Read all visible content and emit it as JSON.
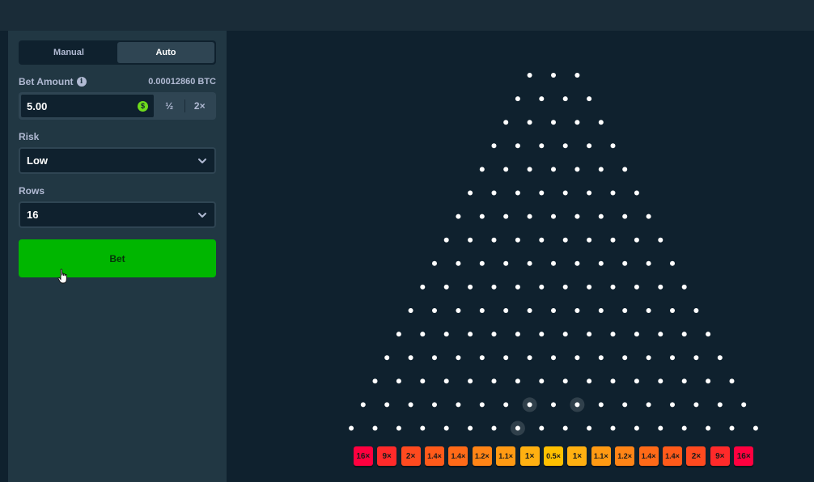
{
  "sidebar": {
    "tabs": [
      {
        "label": "Manual",
        "active": false
      },
      {
        "label": "Auto",
        "active": true
      }
    ],
    "bet_amount": {
      "label": "Bet Amount",
      "btc_value": "0.00012860 BTC",
      "value": "5.00",
      "half_label": "½",
      "double_label": "2×"
    },
    "risk": {
      "label": "Risk",
      "value": "Low"
    },
    "rows": {
      "label": "Rows",
      "value": "16"
    },
    "bet_button": "Bet"
  },
  "board": {
    "peg_rows": 16,
    "top_row_pegs": 3,
    "highlighted_pegs": [
      [
        14,
        7
      ],
      [
        14,
        9
      ],
      [
        15,
        7
      ]
    ],
    "multipliers": [
      "16×",
      "9×",
      "2×",
      "1.4×",
      "1.4×",
      "1.2×",
      "1.1×",
      "1×",
      "0.5×",
      "1×",
      "1.1×",
      "1.2×",
      "1.4×",
      "1.4×",
      "2×",
      "9×",
      "16×"
    ],
    "slot_colors": [
      "#ff003f",
      "#ff2a2a",
      "#ff4a1f",
      "#ff5a1a",
      "#ff6a18",
      "#ff8416",
      "#ff9a13",
      "#ffb011",
      "#ffc000",
      "#ffb011",
      "#ff9a13",
      "#ff8416",
      "#ff6a18",
      "#ff5a1a",
      "#ff4a1f",
      "#ff2a2a",
      "#ff003f"
    ]
  },
  "colors": {
    "background": "#0f212e",
    "panel": "#213743",
    "bet_green": "#00b600",
    "peg": "#ffffff"
  }
}
